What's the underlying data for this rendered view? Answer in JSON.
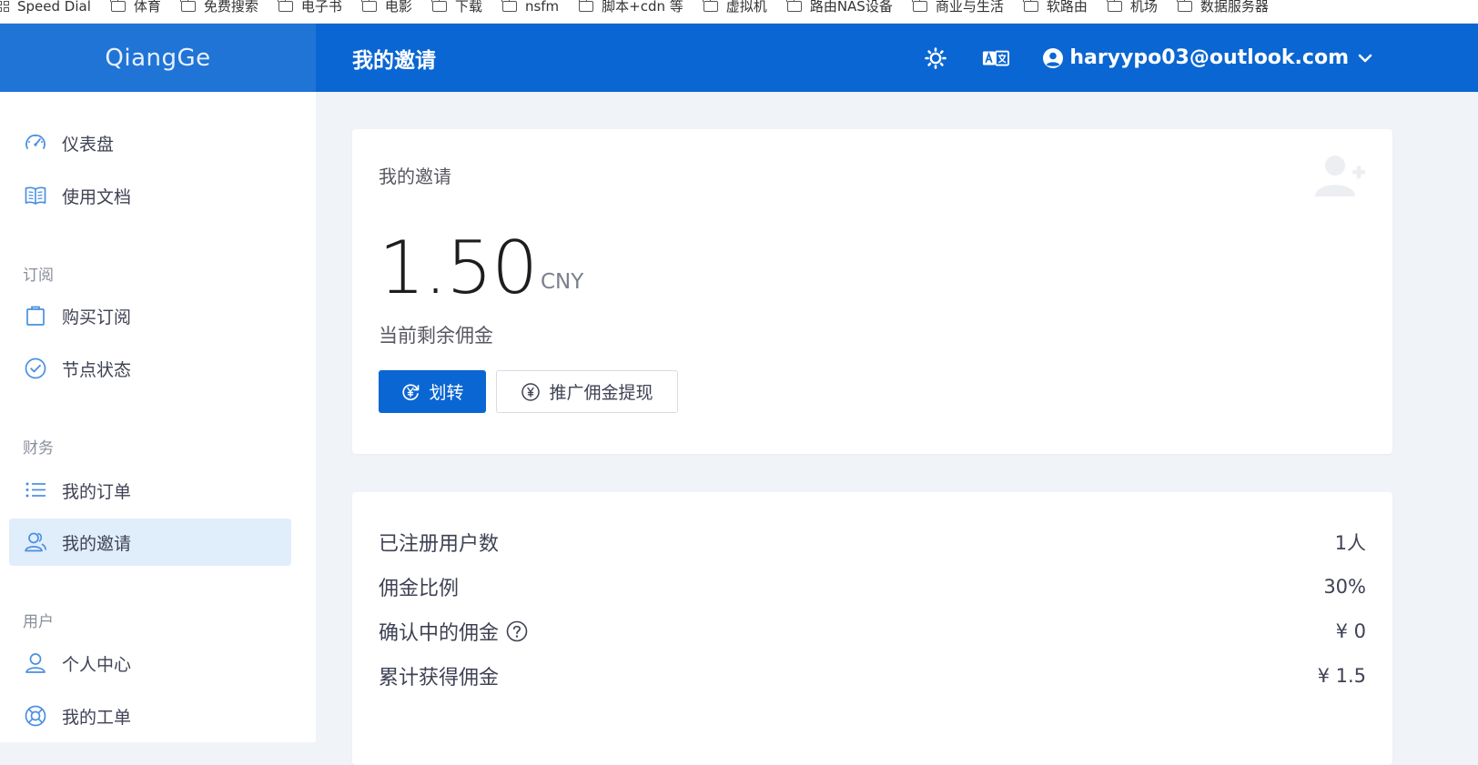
{
  "bookmarks": [
    {
      "label": "Speed Dial",
      "icon": "speed-dial-icon"
    },
    {
      "label": "体育",
      "icon": "folder-icon"
    },
    {
      "label": "免费搜索",
      "icon": "folder-icon"
    },
    {
      "label": "电子书",
      "icon": "folder-icon"
    },
    {
      "label": "电影",
      "icon": "folder-icon"
    },
    {
      "label": "下载",
      "icon": "folder-icon"
    },
    {
      "label": "nsfm",
      "icon": "folder-icon"
    },
    {
      "label": "脚本+cdn 等",
      "icon": "folder-icon"
    },
    {
      "label": "虚拟机",
      "icon": "folder-icon"
    },
    {
      "label": "路由NAS设备",
      "icon": "folder-icon"
    },
    {
      "label": "商业与生活",
      "icon": "folder-icon"
    },
    {
      "label": "软路由",
      "icon": "folder-icon"
    },
    {
      "label": "机场",
      "icon": "folder-icon"
    },
    {
      "label": "数据服务器",
      "icon": "folder-icon"
    }
  ],
  "brand": {
    "name": "QiangGe"
  },
  "header": {
    "title": "我的邀请",
    "user_email": "haryypo03@outlook.com"
  },
  "sidebar": {
    "items_top": [
      {
        "label": "仪表盘",
        "icon": "dashboard-icon"
      },
      {
        "label": "使用文档",
        "icon": "book-icon"
      }
    ],
    "sections": [
      {
        "title": "订阅",
        "items": [
          {
            "label": "购买订阅",
            "icon": "shopping-bag-icon"
          },
          {
            "label": "节点状态",
            "icon": "check-circle-icon"
          }
        ]
      },
      {
        "title": "财务",
        "items": [
          {
            "label": "我的订单",
            "icon": "list-icon"
          },
          {
            "label": "我的邀请",
            "icon": "users-icon",
            "active": true
          }
        ]
      },
      {
        "title": "用户",
        "items": [
          {
            "label": "个人中心",
            "icon": "user-icon"
          },
          {
            "label": "我的工单",
            "icon": "lifebuoy-icon"
          }
        ]
      }
    ]
  },
  "commission_card": {
    "title": "我的邀请",
    "amount": "1.50",
    "currency": "CNY",
    "amount_label": "当前剩余佣金",
    "transfer_button": "划转",
    "withdraw_button": "推广佣金提现"
  },
  "stats": [
    {
      "label": "已注册用户数",
      "value": "1人"
    },
    {
      "label": "佣金比例",
      "value": "30%"
    },
    {
      "label": "确认中的佣金",
      "value": "¥ 0",
      "help": true
    },
    {
      "label": "累计获得佣金",
      "value": "¥ 1.5"
    }
  ],
  "colors": {
    "primary": "#0a66d2",
    "brand_bg": "#1f74d6",
    "active_bg": "#e0edfb",
    "page_bg": "#f0f3f8"
  }
}
